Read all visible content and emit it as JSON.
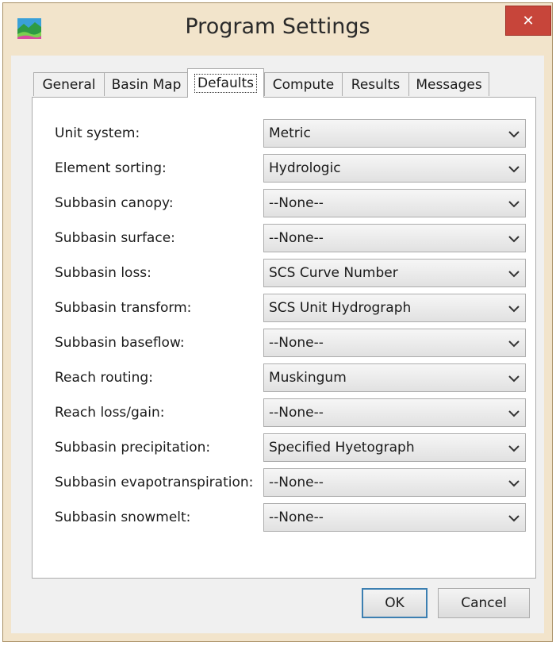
{
  "window": {
    "title": "Program Settings",
    "close_glyph": "✕",
    "app_icon": "hec-hms-landscape-icon"
  },
  "tabs": [
    {
      "label": "General",
      "active": false
    },
    {
      "label": "Basin Map",
      "active": false
    },
    {
      "label": "Defaults",
      "active": true
    },
    {
      "label": "Compute",
      "active": false
    },
    {
      "label": "Results",
      "active": false
    },
    {
      "label": "Messages",
      "active": false
    }
  ],
  "settings": [
    {
      "label": "Unit system:",
      "value": "Metric"
    },
    {
      "label": "Element sorting:",
      "value": "Hydrologic"
    },
    {
      "label": "Subbasin canopy:",
      "value": "--None--"
    },
    {
      "label": "Subbasin surface:",
      "value": "--None--"
    },
    {
      "label": "Subbasin loss:",
      "value": "SCS Curve Number"
    },
    {
      "label": "Subbasin transform:",
      "value": "SCS Unit Hydrograph"
    },
    {
      "label": "Subbasin baseflow:",
      "value": "--None--"
    },
    {
      "label": "Reach routing:",
      "value": "Muskingum"
    },
    {
      "label": "Reach loss/gain:",
      "value": "--None--"
    },
    {
      "label": "Subbasin precipitation:",
      "value": "Specified Hyetograph"
    },
    {
      "label": "Subbasin evapotranspiration:",
      "value": "--None--"
    },
    {
      "label": "Subbasin snowmelt:",
      "value": "--None--"
    }
  ],
  "buttons": {
    "ok": "OK",
    "cancel": "Cancel"
  },
  "colors": {
    "title_bar": "#f2e4cb",
    "close_button": "#c7453a",
    "default_button_border": "#3c7fb1"
  }
}
